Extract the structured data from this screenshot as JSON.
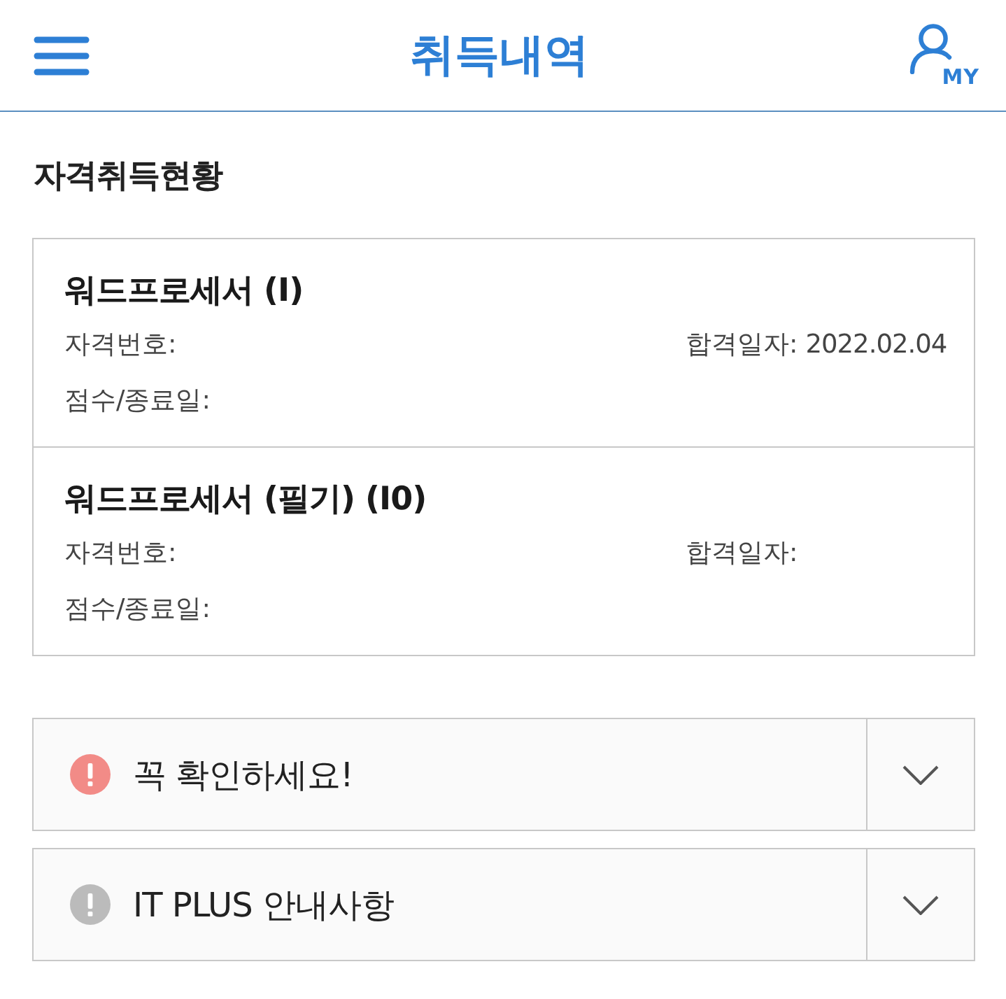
{
  "header": {
    "title": "취득내역",
    "my_label": "MY"
  },
  "section": {
    "title": "자격취득현황"
  },
  "certificates": [
    {
      "name": "워드프로세서 (I)",
      "number_label": "자격번호:",
      "pass_date_label": "합격일자:",
      "pass_date": "2022.02.04",
      "score_label": "점수/종료일:"
    },
    {
      "name": "워드프로세서 (필기) (I0)",
      "number_label": "자격번호:",
      "pass_date_label": "합격일자:",
      "score_label": "점수/종료일:"
    }
  ],
  "notices": [
    {
      "label": "꼭 확인하세요!",
      "color": "#f28b87",
      "expanded": false
    },
    {
      "label": "IT PLUS 안내사항",
      "color": "#bbbbbb",
      "expanded": false
    }
  ]
}
